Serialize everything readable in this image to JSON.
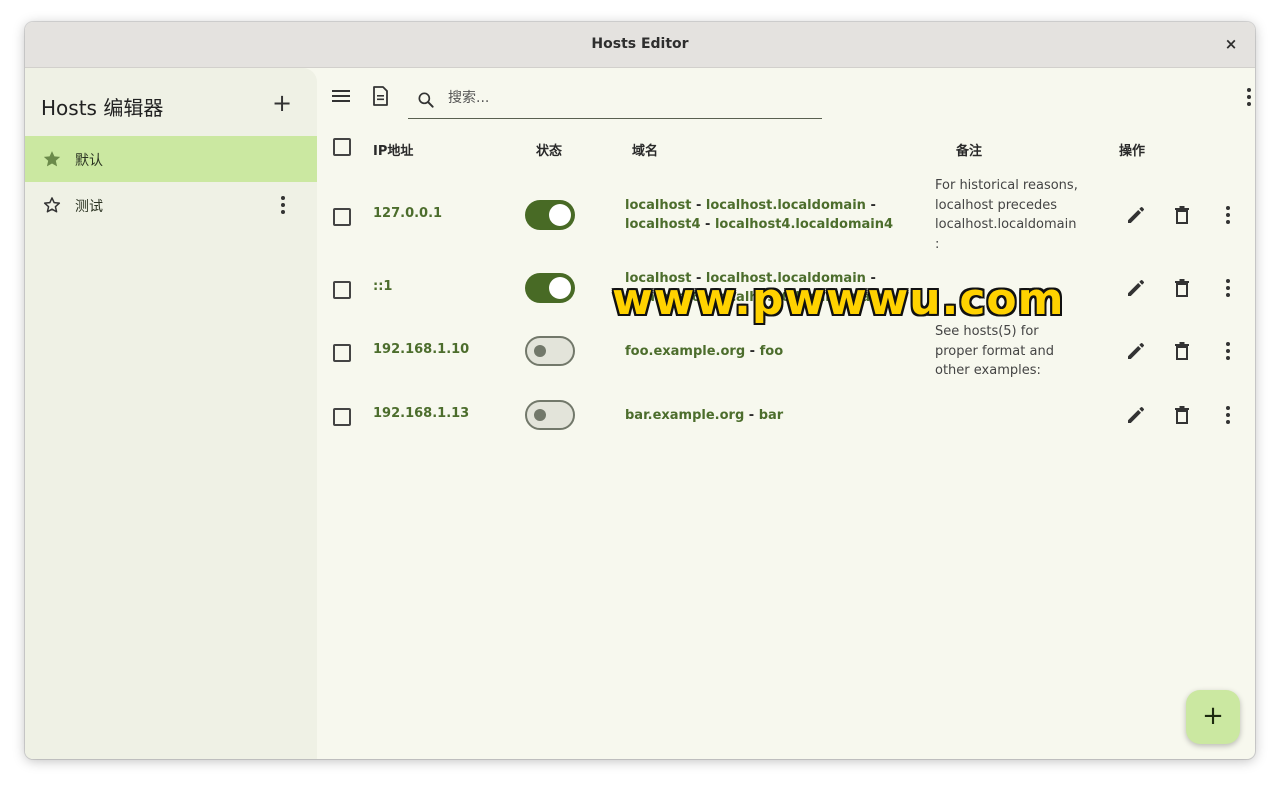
{
  "window": {
    "title": "Hosts Editor",
    "close_glyph": "×"
  },
  "sidebar": {
    "app_title": "Hosts 编辑器",
    "add_glyph": "+",
    "items": [
      {
        "label": "默认",
        "icon": "star-filled-icon",
        "active": true
      },
      {
        "label": "测试",
        "icon": "star-outline-icon",
        "active": false
      }
    ]
  },
  "toolbar": {
    "search_placeholder": "搜索..."
  },
  "table": {
    "headers": {
      "ip": "IP地址",
      "status": "状态",
      "domain": "域名",
      "note": "备注",
      "actions": "操作"
    },
    "rows": [
      {
        "ip": "127.0.0.1",
        "enabled": true,
        "domains": [
          "localhost",
          "localhost.localdomain",
          "localhost4",
          "localhost4.localdomain4"
        ],
        "note": "For historical reasons, localhost precedes localhost.localdomain :"
      },
      {
        "ip": "::1",
        "enabled": true,
        "domains": [
          "localhost",
          "localhost.localdomain",
          "localhost6",
          "localhost6.localdomain6"
        ],
        "note": ""
      },
      {
        "ip": "192.168.1.10",
        "enabled": false,
        "domains": [
          "foo.example.org",
          "foo"
        ],
        "note": "See hosts(5) for proper format and other examples:"
      },
      {
        "ip": "192.168.1.13",
        "enabled": false,
        "domains": [
          "bar.example.org",
          "bar"
        ],
        "note": ""
      }
    ],
    "domain_separator": " - "
  },
  "fab_glyph": "+",
  "watermark": "www.pwwwu.com",
  "colors": {
    "accent": "#486a25",
    "active_item": "#cbe8a1",
    "domain_text": "#4c6d2c",
    "background": "#f7f8ee"
  }
}
